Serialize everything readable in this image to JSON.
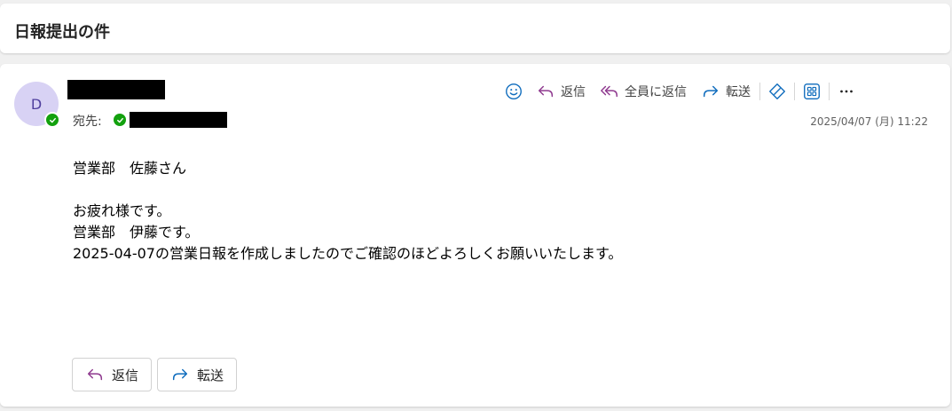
{
  "subject": "日報提出の件",
  "sender": {
    "avatar_initial": "D"
  },
  "recipient": {
    "to_label": "宛先:"
  },
  "toolbar": {
    "reply_label": "返信",
    "reply_all_label": "全員に返信",
    "forward_label": "転送"
  },
  "timestamp": "2025/04/07 (月) 11:22",
  "body": {
    "line1": "営業部　佐藤さん",
    "line2": "お疲れ様です。",
    "line3": "営業部　伊藤です。",
    "line4": "2025-04-07の営業日報を作成しましたのでご確認のほどよろしくお願いいたします。"
  },
  "actions": {
    "reply_label": "返信",
    "forward_label": "転送"
  },
  "colors": {
    "reply_icon": "#8f3a8f",
    "forward_icon": "#0f6cbd",
    "presence": "#13a10e",
    "avatar_bg": "#d8d2f4"
  }
}
